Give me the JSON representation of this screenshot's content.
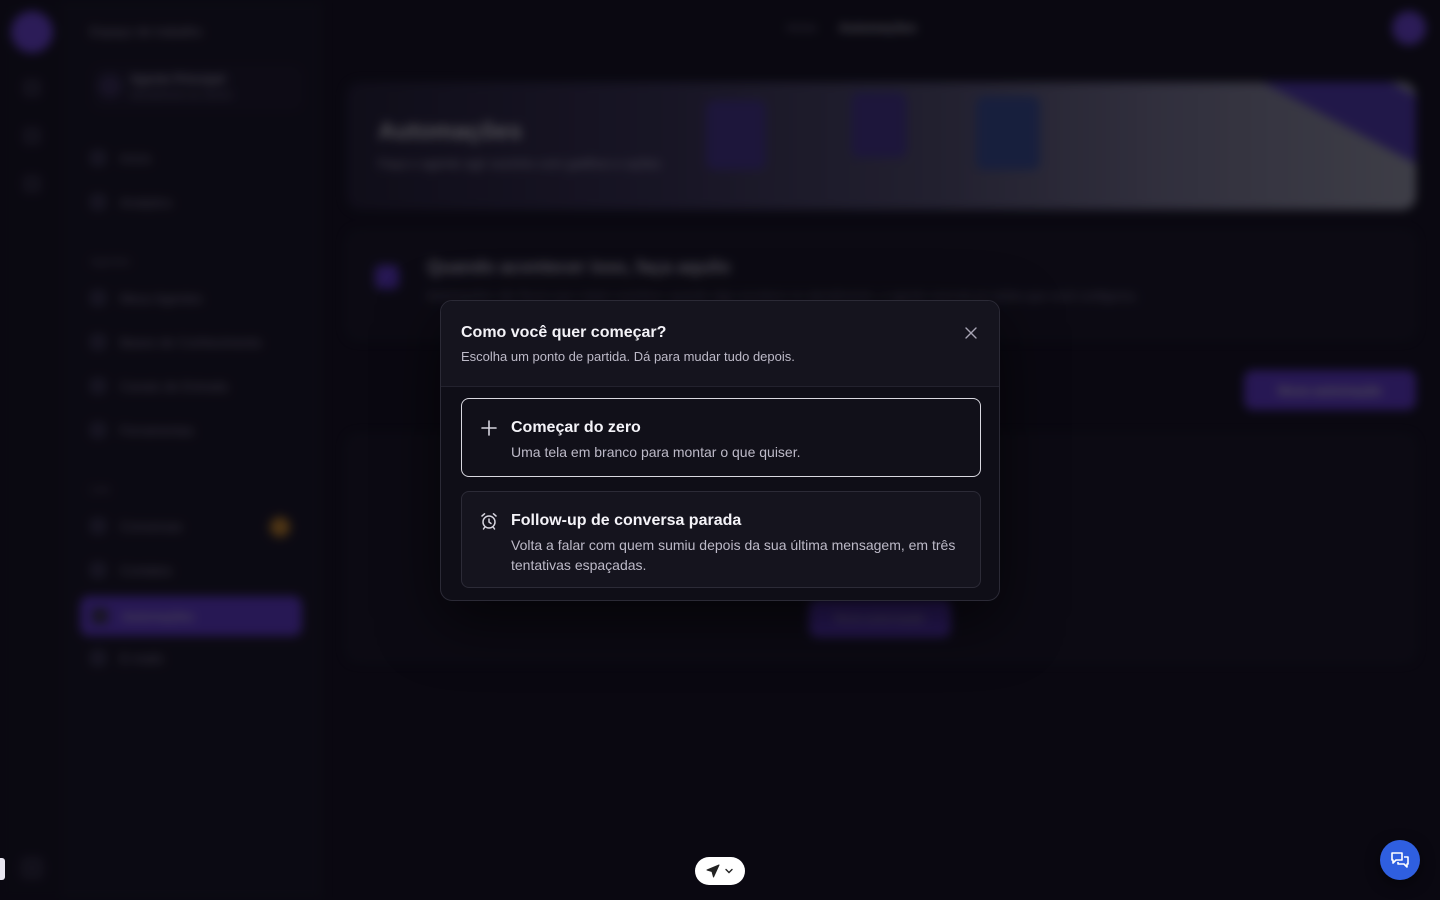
{
  "background": {
    "workspace": "Espaço de trabalho",
    "agent_name": "Agente Principal",
    "agent_sub": "Atendimento ao cliente",
    "nav_top": [
      "Início",
      "Analytics"
    ],
    "section_agents": "Agentes",
    "nav_agents": [
      "Meus Agentes",
      "Bases de Conhecimento",
      "Canais de Entrada",
      "Ferramentas"
    ],
    "section_live": "Live",
    "nav_live": [
      "Conversas",
      "Contatos",
      "Automações",
      "E-mails"
    ],
    "breadcrumb_parent": "Início",
    "breadcrumb_current": "Automações",
    "hero_title": "Automações",
    "hero_subtitle": "Faça o agente agir sozinho com gatilhos e ações",
    "info_title": "Quando acontecer isso, faça aquilo",
    "info_text": "Automações são fluxos que rodam sozinhos: quando algo acontece no atendimento, o agente executa as ações que você configurou.",
    "new_button": "Nova automação",
    "empty_button": "Nova automação"
  },
  "modal": {
    "title": "Como você quer começar?",
    "subtitle": "Escolha um ponto de partida. Dá para mudar tudo depois.",
    "options": [
      {
        "icon": "plus-icon",
        "title": "Começar do zero",
        "description": "Uma tela em branco para montar o que quiser."
      },
      {
        "icon": "alarm-clock-icon",
        "title": "Follow-up de conversa parada",
        "description": "Volta a falar com quem sumiu depois da sua última mensagem, em três tentativas espaçadas."
      }
    ]
  },
  "colors": {
    "accent": "#6d3ff2",
    "modal_bg": "#0f0e17",
    "chat_fab": "#2f5fe0"
  }
}
